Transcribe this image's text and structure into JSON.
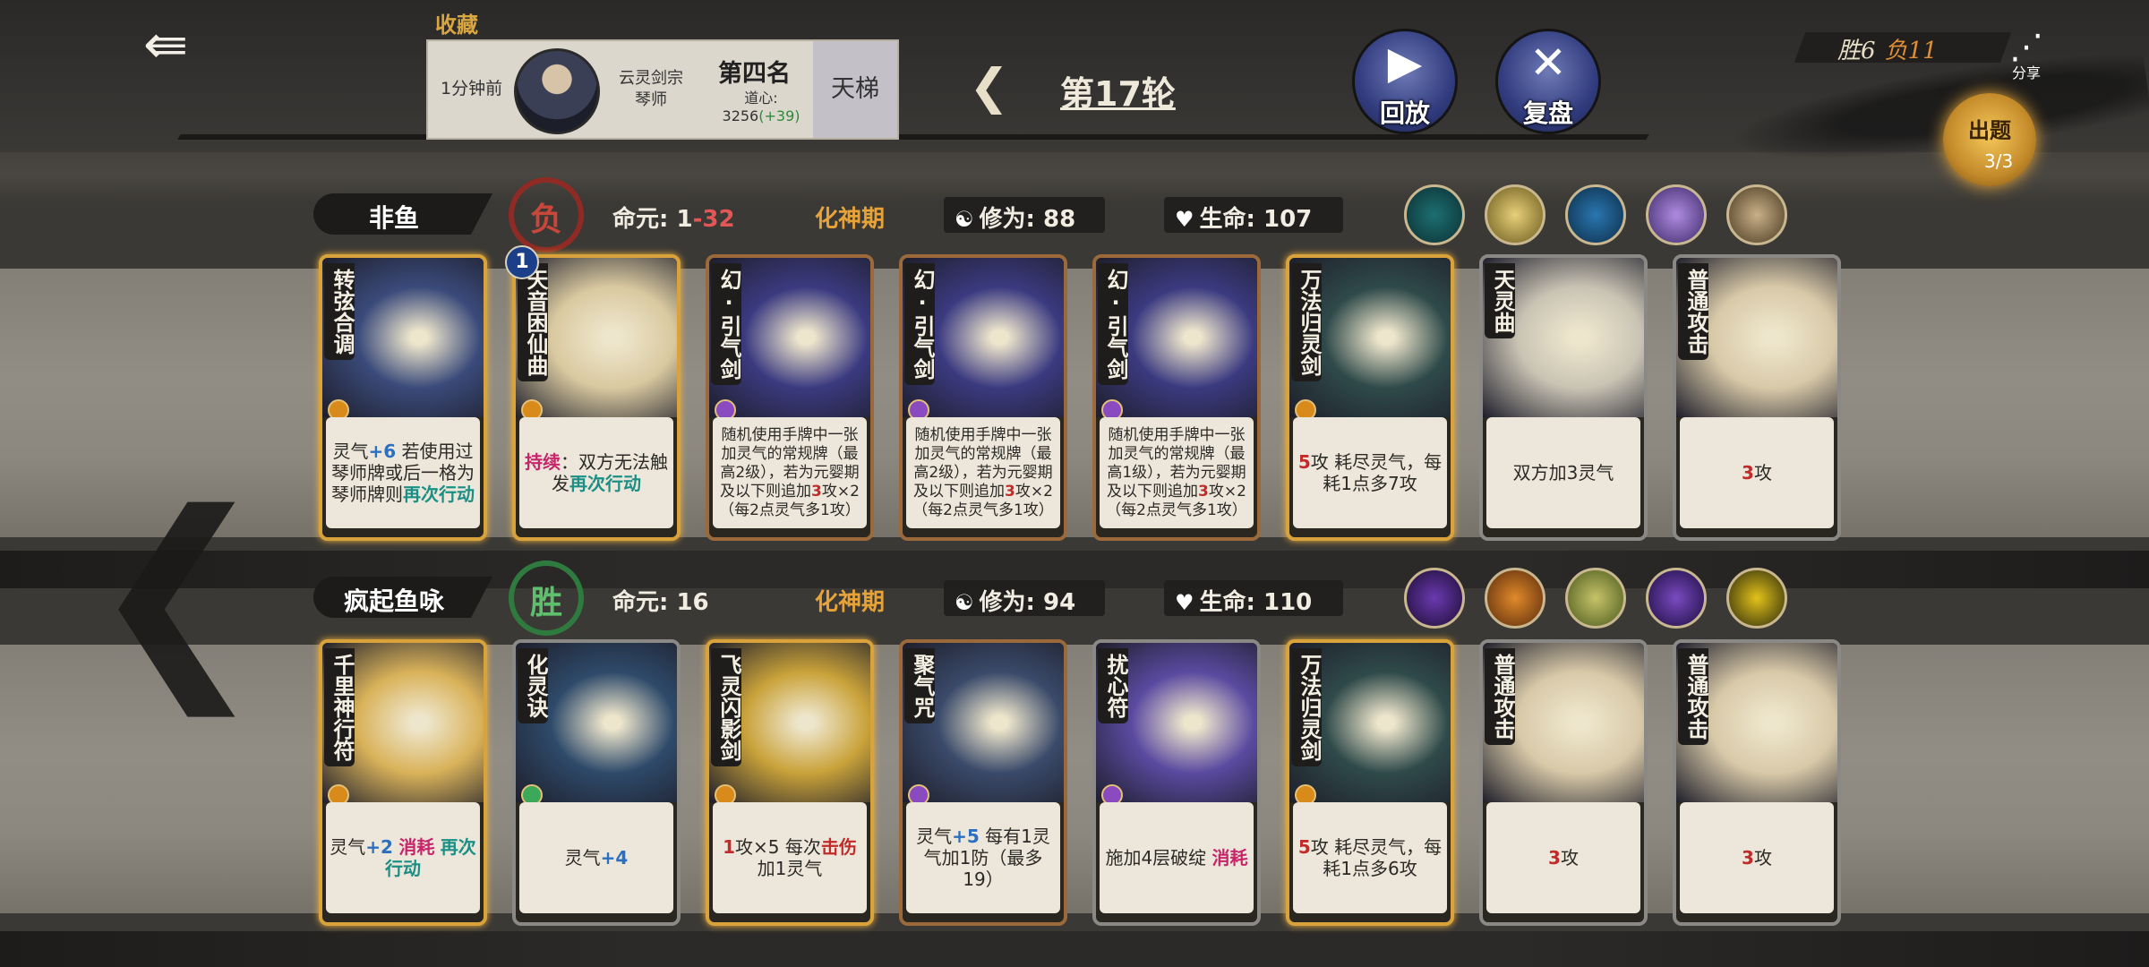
{
  "header": {
    "back_icon": "back-arrow-icon",
    "collect_label": "收藏",
    "opponent": {
      "time_ago": "1分钟前",
      "sect_line1": "云灵剑宗",
      "sect_line2": "琴师",
      "rank": "第四名",
      "dao_label": "道心:",
      "dao_value": "3256",
      "dao_delta": "(+39)",
      "mode": "天梯"
    },
    "round": "第17轮",
    "replay_label": "回放",
    "review_label": "复盘",
    "record_win": "胜6",
    "record_lose": "负11",
    "share_label": "分享",
    "quiz_label": "出题",
    "quiz_count": "3/3"
  },
  "players": [
    {
      "name": "非鱼",
      "result": "负",
      "life_label": "命元:",
      "life_value": "1",
      "life_delta": "-32",
      "realm": "化神期",
      "cultivation_label": "修为:",
      "cultivation_value": "88",
      "hp_label": "生命:",
      "hp_value": "107",
      "buff_icons": [
        "eye-buff-icon",
        "lantern-buff-icon",
        "taiji-buff-icon",
        "figure-buff-icon",
        "sword-buff-icon"
      ],
      "cards": [
        {
          "name": "转弦合调",
          "lines": [
            {
              "t": "灵气"
            },
            {
              "t": "+6",
              "c": "c-blue"
            },
            {
              "t": " 若使用过琴师牌或后一格为琴师牌则"
            },
            {
              "t": "再次行动",
              "c": "c-teal"
            }
          ]
        },
        {
          "name": "天音困仙曲",
          "level": "1",
          "lines": [
            {
              "t": "持续",
              "c": "c-pink"
            },
            {
              "t": "：双方无法触发"
            },
            {
              "t": "再次行动",
              "c": "c-teal"
            }
          ]
        },
        {
          "name": "幻·引气剑",
          "small": true,
          "lines": [
            {
              "t": "随机使用手牌中一张加灵气的常规牌（最高2级），若为元婴期及以下则追加"
            },
            {
              "t": "3",
              "c": "c-red"
            },
            {
              "t": "攻×2（每2点灵气多1攻）"
            }
          ]
        },
        {
          "name": "幻·引气剑",
          "small": true,
          "lines": [
            {
              "t": "随机使用手牌中一张加灵气的常规牌（最高2级），若为元婴期及以下则追加"
            },
            {
              "t": "3",
              "c": "c-red"
            },
            {
              "t": "攻×2（每2点灵气多1攻）"
            }
          ]
        },
        {
          "name": "幻·引气剑",
          "small": true,
          "lines": [
            {
              "t": "随机使用手牌中一张加灵气的常规牌（最高1级），若为元婴期及以下则追加"
            },
            {
              "t": "3",
              "c": "c-red"
            },
            {
              "t": "攻×2（每2点灵气多1攻）"
            }
          ]
        },
        {
          "name": "万法归灵剑",
          "lines": [
            {
              "t": "5",
              "c": "c-red"
            },
            {
              "t": "攻 耗尽灵气，每耗1点多7攻"
            }
          ]
        },
        {
          "name": "天灵曲",
          "lines": [
            {
              "t": "双方加3灵气"
            }
          ]
        },
        {
          "name": "普通攻击",
          "lines": [
            {
              "t": "3",
              "c": "c-red"
            },
            {
              "t": "攻"
            }
          ]
        }
      ]
    },
    {
      "name": "疯起鱼咏",
      "result": "胜",
      "life_label": "命元:",
      "life_value": "16",
      "life_delta": "",
      "realm": "化神期",
      "cultivation_label": "修为:",
      "cultivation_value": "94",
      "hp_label": "生命:",
      "hp_value": "110",
      "buff_icons": [
        "vortex-buff-icon",
        "flame-buff-icon",
        "warrior-buff-icon",
        "shadow-buff-icon",
        "silhouette-buff-icon"
      ],
      "cards": [
        {
          "name": "千里神行符",
          "lines": [
            {
              "t": "灵气"
            },
            {
              "t": "+2",
              "c": "c-blue"
            },
            {
              "t": " "
            },
            {
              "t": "消耗",
              "c": "c-pink"
            },
            {
              "t": " "
            },
            {
              "t": "再次行动",
              "c": "c-teal"
            }
          ]
        },
        {
          "name": "化灵诀",
          "lines": [
            {
              "t": "灵气"
            },
            {
              "t": "+4",
              "c": "c-blue"
            }
          ]
        },
        {
          "name": "飞灵闪影剑",
          "lines": [
            {
              "t": "1",
              "c": "c-red"
            },
            {
              "t": "攻×5 每次"
            },
            {
              "t": "击伤",
              "c": "c-red"
            },
            {
              "t": "加1灵气"
            }
          ]
        },
        {
          "name": "聚气咒",
          "lines": [
            {
              "t": "灵气"
            },
            {
              "t": "+5",
              "c": "c-blue"
            },
            {
              "t": " 每有1灵气加1防（最多19）"
            }
          ]
        },
        {
          "name": "扰心符",
          "lines": [
            {
              "t": "施加4层破绽 "
            },
            {
              "t": "消耗",
              "c": "c-pink"
            }
          ]
        },
        {
          "name": "万法归灵剑",
          "lines": [
            {
              "t": "5",
              "c": "c-red"
            },
            {
              "t": "攻 耗尽灵气，每耗1点多6攻"
            }
          ]
        },
        {
          "name": "普通攻击",
          "lines": [
            {
              "t": "3",
              "c": "c-red"
            },
            {
              "t": "攻"
            }
          ]
        },
        {
          "name": "普通攻击",
          "lines": [
            {
              "t": "3",
              "c": "c-red"
            },
            {
              "t": "攻"
            }
          ]
        }
      ]
    }
  ]
}
